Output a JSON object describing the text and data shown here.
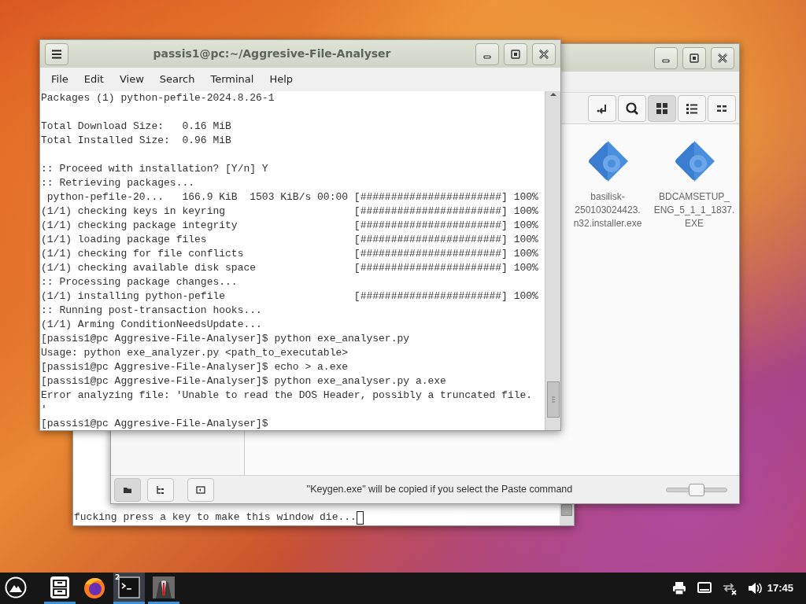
{
  "back_terminal": {
    "lines": [
      "fucking press a key to make this window die..."
    ]
  },
  "file_manager": {
    "toolbar": [
      {
        "kind": "jump",
        "selected": false
      },
      {
        "kind": "search",
        "selected": false
      },
      {
        "kind": "icons",
        "selected": true
      },
      {
        "kind": "list",
        "selected": false
      },
      {
        "kind": "compact",
        "selected": false
      }
    ],
    "items": [
      {
        "label_lines": [
          "basilisk-",
          "250103024423.",
          "n32.installer.exe"
        ]
      },
      {
        "label_lines": [
          "BDCAMSETUP_",
          "ENG_5_1_1_1837.",
          "EXE"
        ]
      }
    ],
    "side_buttons": [
      {
        "kind": "places",
        "selected": true
      },
      {
        "kind": "tree",
        "selected": false
      },
      {
        "kind": "panel",
        "selected": false
      }
    ],
    "status_text": "\"Keygen.exe\" will be copied if you select the Paste command",
    "zoom_slider": {
      "level": 0.5
    }
  },
  "terminal": {
    "title": "passis1@pc:~/Aggresive-File-Analyser",
    "menu": [
      "File",
      "Edit",
      "View",
      "Search",
      "Terminal",
      "Help"
    ],
    "paragraphs": [
      [
        "Packages (1) python-pefile-2024.8.26-1"
      ],
      [
        "Total Download Size:   0.16 MiB",
        "Total Installed Size:  0.96 MiB"
      ],
      [
        ":: Proceed with installation? [Y/n] Y",
        ":: Retrieving packages...",
        " python-pefile-20...   166.9 KiB  1503 KiB/s 00:00 [#######################] 100%",
        "(1/1) checking keys in keyring                     [#######################] 100%",
        "(1/1) checking package integrity                   [#######################] 100%",
        "(1/1) loading package files                        [#######################] 100%",
        "(1/1) checking for file conflicts                  [#######################] 100%",
        "(1/1) checking available disk space                [#######################] 100%",
        ":: Processing package changes...",
        "(1/1) installing python-pefile                     [#######################] 100%",
        ":: Running post-transaction hooks...",
        "(1/1) Arming ConditionNeedsUpdate...",
        "[passis1@pc Aggresive-File-Analyser]$ python exe_analyser.py",
        "Usage: python exe_analyzer.py <path_to_executable>",
        "[passis1@pc Aggresive-File-Analyser]$ echo > a.exe",
        "[passis1@pc Aggresive-File-Analyser]$ python exe_analyser.py a.exe",
        "Error analyzing file: 'Unable to read the DOS Header, possibly a truncated file.",
        "'",
        "[passis1@pc Aggresive-File-Analyser]$"
      ]
    ]
  },
  "taskbar": {
    "apps": [
      {
        "kind": "files",
        "running": true,
        "active": false
      },
      {
        "kind": "browser",
        "running": false,
        "active": false
      },
      {
        "kind": "terminal",
        "running": true,
        "active": true,
        "badge": "2"
      },
      {
        "kind": "suit",
        "running": true,
        "active": false
      }
    ],
    "tray": [
      {
        "kind": "printer"
      },
      {
        "kind": "display"
      },
      {
        "kind": "network"
      },
      {
        "kind": "volume"
      }
    ],
    "clock": "17:45"
  }
}
